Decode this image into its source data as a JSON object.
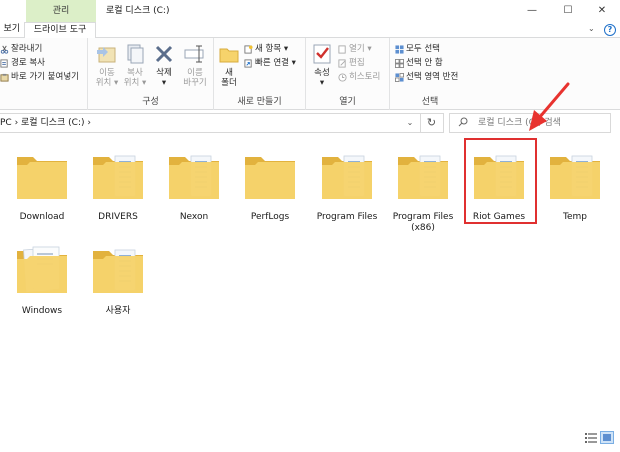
{
  "window": {
    "context_tab": "관리",
    "title": "로컬 디스크 (C:)",
    "minimize": "—",
    "maximize": "☐",
    "close": "✕"
  },
  "tabs": {
    "view_partial": "보기",
    "drive_tools": "드라이브 도구"
  },
  "ribbon": {
    "clipboard": {
      "cut": "잘라내기",
      "copy_path": "경로 복사",
      "paste_shortcut": "바로 가기 붙여넣기"
    },
    "organize": {
      "label": "구성",
      "move_to": [
        "이동",
        "위치 ▾"
      ],
      "copy_to": [
        "복사",
        "위치 ▾"
      ],
      "delete": [
        "삭제",
        "▾"
      ],
      "rename": [
        "이름",
        "바꾸기"
      ]
    },
    "new": {
      "label": "새로 만들기",
      "new_folder": [
        "새",
        "폴더"
      ],
      "new_item": "새 항목 ▾",
      "easy_access": "빠른 연결 ▾"
    },
    "open": {
      "label": "열기",
      "properties": [
        "속성",
        "▾"
      ],
      "open": "열기 ▾",
      "edit": "편집",
      "history": "히스토리"
    },
    "select": {
      "label": "선택",
      "select_all": "모두 선택",
      "select_none": "선택 안 함",
      "invert_selection": "선택 영역 반전"
    }
  },
  "address": {
    "path": "PC  ›  로컬 디스크 (C:)  ›",
    "dropdown": "⌄",
    "refresh": "↻"
  },
  "search": {
    "placeholder": "로컬 디스크 (C:) 검색"
  },
  "folders": [
    {
      "name": "Download",
      "type": "empty"
    },
    {
      "name": "DRIVERS",
      "type": "docs"
    },
    {
      "name": "Nexon",
      "type": "docs"
    },
    {
      "name": "PerfLogs",
      "type": "empty"
    },
    {
      "name": "Program Files",
      "type": "docs"
    },
    {
      "name": "Program Files\n(x86)",
      "type": "docs"
    },
    {
      "name": "Riot Games",
      "type": "docs"
    },
    {
      "name": "Temp",
      "type": "docs"
    },
    {
      "name": "Windows",
      "type": "windows"
    },
    {
      "name": "사용자",
      "type": "docs"
    }
  ],
  "colors": {
    "folder": "#f6d36b",
    "folder_dark": "#e2b23e",
    "highlight": "#e03030",
    "arrow": "#e8332f",
    "accent": "#1e70c9"
  }
}
